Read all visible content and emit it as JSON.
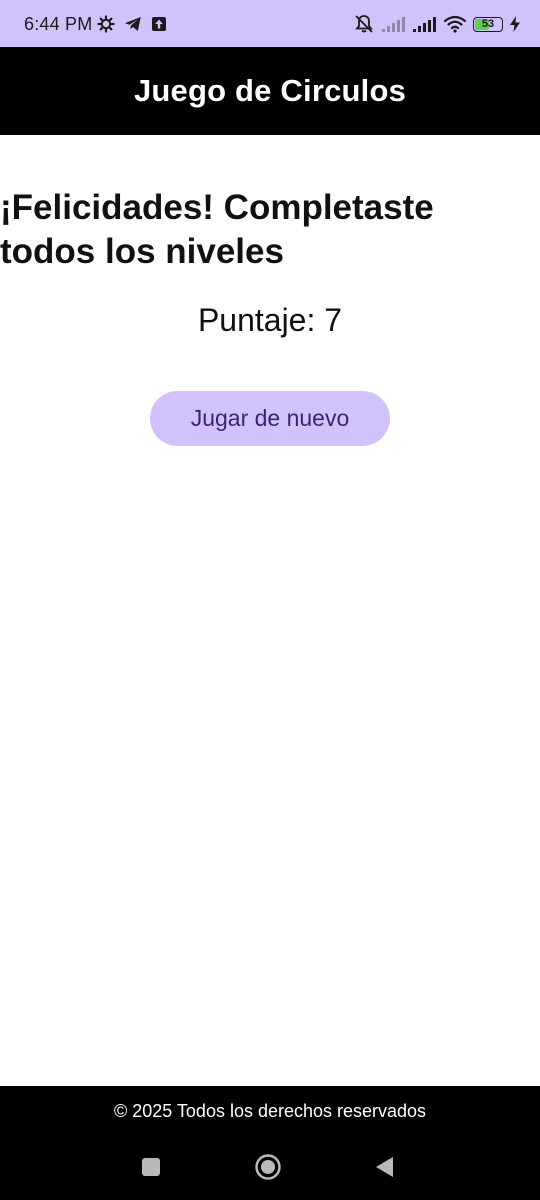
{
  "status_bar": {
    "time": "6:44 PM",
    "left_icons": [
      "settings-gear-icon",
      "telegram-icon",
      "upload-icon"
    ],
    "right_icons": [
      "muted-bell-icon",
      "signal-icon",
      "signal-icon",
      "wifi-icon",
      "battery-icon",
      "charging-icon"
    ],
    "battery_level": "53",
    "battery_fraction": 0.53
  },
  "app_bar": {
    "title": "Juego de Circulos"
  },
  "main": {
    "headline": "¡Felicidades! Completaste todos los niveles",
    "score_text": "Puntaje: 7",
    "replay_button_label": "Jugar de nuevo"
  },
  "footer": {
    "copyright": "© 2025 Todos los derechos reservados"
  },
  "nav_bar": {
    "buttons": [
      "recents-square-icon",
      "home-circle-icon",
      "back-triangle-icon"
    ]
  },
  "colors": {
    "status_bar_bg": "#d2c2fc",
    "button_bg": "#d2c2fc",
    "button_text": "#3b2470",
    "app_bar_bg": "#000000",
    "battery_fill": "#5bd04c"
  }
}
